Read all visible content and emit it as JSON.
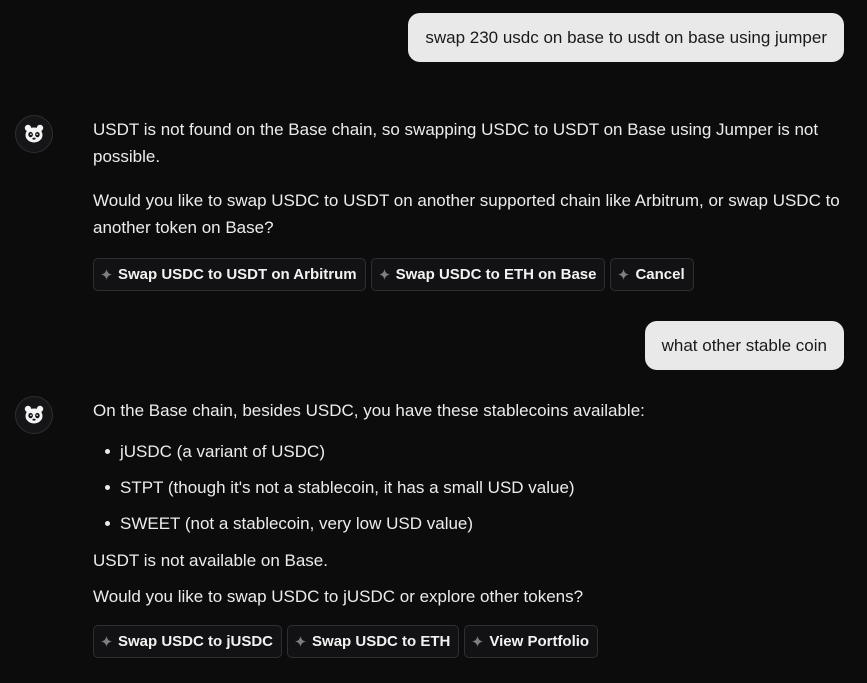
{
  "conversation": [
    {
      "role": "user",
      "text": "swap 230 usdc on base to usdt on base using jumper"
    },
    {
      "role": "assistant",
      "avatar_icon": "panda-face-icon",
      "paragraphs": [
        "USDT is not found on the Base chain, so swapping USDC to USDT on Base using Jumper is not possible.",
        "Would you like to swap USDC to USDT on another supported chain like Arbitrum, or swap USDC to another token on Base?"
      ],
      "suggestions": [
        "Swap USDC to USDT on Arbitrum",
        "Swap USDC to ETH on Base",
        "Cancel"
      ]
    },
    {
      "role": "user",
      "text": "what other stable coin"
    },
    {
      "role": "assistant",
      "avatar_icon": "panda-face-icon",
      "intro": "On the Base chain, besides USDC, you have these stablecoins available:",
      "bullets": [
        "jUSDC (a variant of USDC)",
        "STPT (though it's not a stablecoin, it has a small USD value)",
        "SWEET (not a stablecoin, very low USD value)"
      ],
      "paragraphs_after": [
        "USDT is not available on Base.",
        "Would you like to swap USDC to jUSDC or explore other tokens?"
      ],
      "suggestions": [
        "Swap USDC to jUSDC",
        "Swap USDC to ETH",
        "View Portfolio"
      ]
    }
  ],
  "colors": {
    "background": "#0c0c0d",
    "user_bubble": "#e9e9ea",
    "text": "#ececec",
    "chip_border": "#2f2f33"
  }
}
